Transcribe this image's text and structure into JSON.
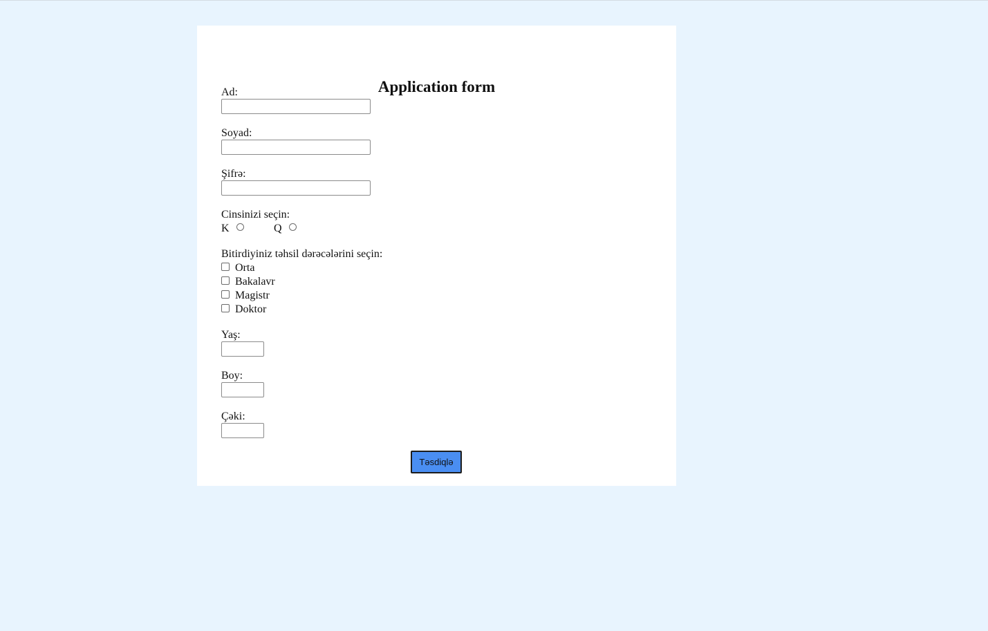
{
  "form": {
    "title": "Application form",
    "first_name": {
      "label": "Ad:",
      "value": ""
    },
    "last_name": {
      "label": "Soyad:",
      "value": ""
    },
    "password": {
      "label": "Şifrə:",
      "value": ""
    },
    "gender": {
      "label": "Cinsinizi seçin:",
      "options": [
        {
          "label": "K",
          "checked": false
        },
        {
          "label": "Q",
          "checked": false
        }
      ]
    },
    "education": {
      "label": "Bitirdiyiniz təhsil dərəcələrini seçin:",
      "options": [
        {
          "label": "Orta",
          "checked": false
        },
        {
          "label": "Bakalavr",
          "checked": false
        },
        {
          "label": "Magistr",
          "checked": false
        },
        {
          "label": "Doktor",
          "checked": false
        }
      ]
    },
    "age": {
      "label": "Yaş:",
      "value": ""
    },
    "height": {
      "label": "Boy:",
      "value": ""
    },
    "weight": {
      "label": "Çəki:",
      "value": ""
    },
    "submit_label": "Təsdiqlə"
  },
  "colors": {
    "page_background": "#e8f4fe",
    "card_background": "#ffffff",
    "button_background": "#4a8ef2"
  }
}
